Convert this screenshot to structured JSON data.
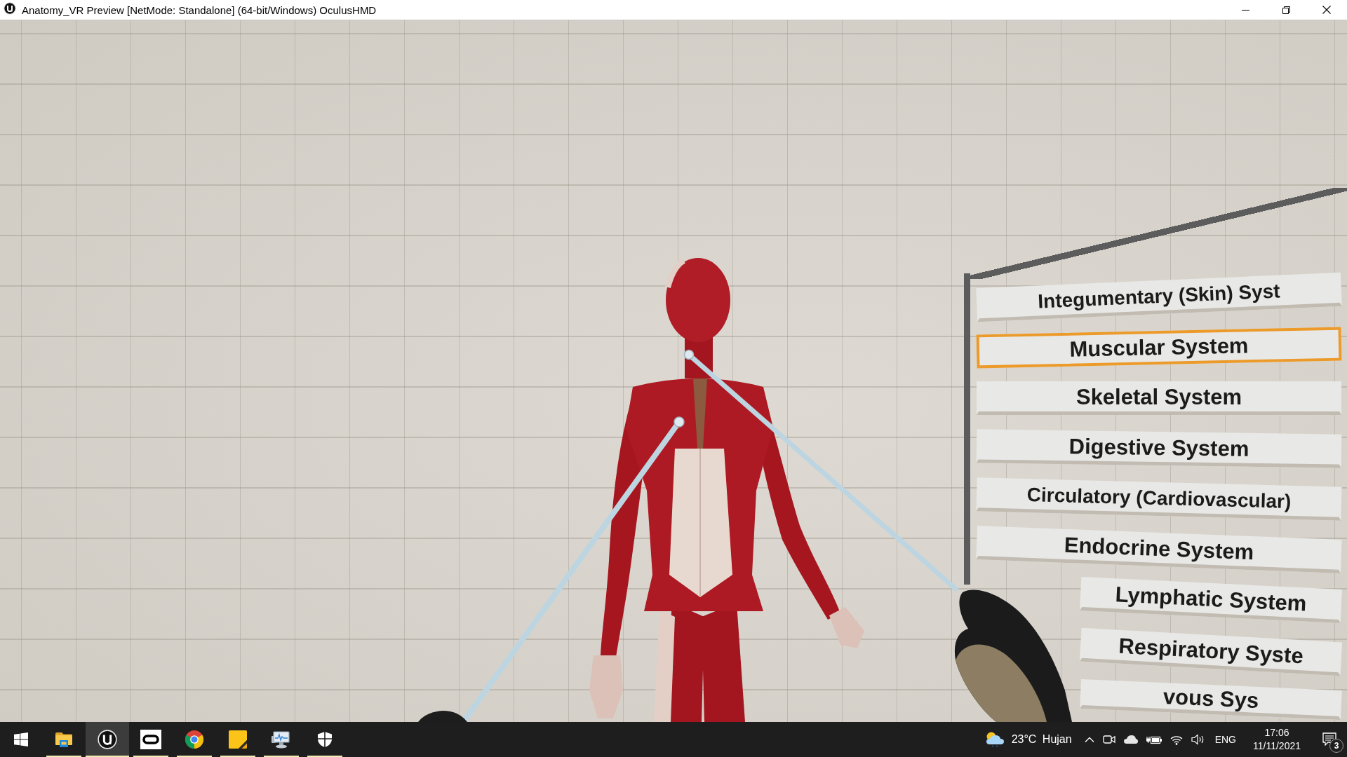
{
  "window": {
    "title": "Anatomy_VR Preview [NetMode: Standalone] (64-bit/Windows) OculusHMD"
  },
  "scene": {
    "menu": {
      "items": [
        {
          "label": "Integumentary (Skin) Syst",
          "selected": false
        },
        {
          "label": "Muscular System",
          "selected": true
        },
        {
          "label": "Skeletal System",
          "selected": false
        },
        {
          "label": "Digestive System",
          "selected": false
        },
        {
          "label": "Circulatory (Cardiovascular)",
          "selected": false
        },
        {
          "label": "Endocrine System",
          "selected": false
        },
        {
          "label": "Lymphatic System",
          "selected": false
        },
        {
          "label": "Respiratory Syste",
          "selected": false
        },
        {
          "label": "vous Sys",
          "selected": false
        }
      ]
    }
  },
  "taskbar": {
    "apps": [
      {
        "kind": "explorer",
        "running": true,
        "selected": false
      },
      {
        "kind": "engine",
        "running": true,
        "selected": true
      },
      {
        "kind": "headset",
        "running": true,
        "selected": false
      },
      {
        "kind": "browser",
        "running": true,
        "selected": false
      },
      {
        "kind": "notes",
        "running": true,
        "selected": false
      },
      {
        "kind": "monitor",
        "running": true,
        "selected": false
      },
      {
        "kind": "security",
        "running": true,
        "selected": false
      }
    ],
    "weather": {
      "label": "23°C Hujan"
    },
    "tray": {
      "language": "ENG",
      "time": "17:06",
      "date": "11/11/2021",
      "notifications": "3"
    }
  }
}
